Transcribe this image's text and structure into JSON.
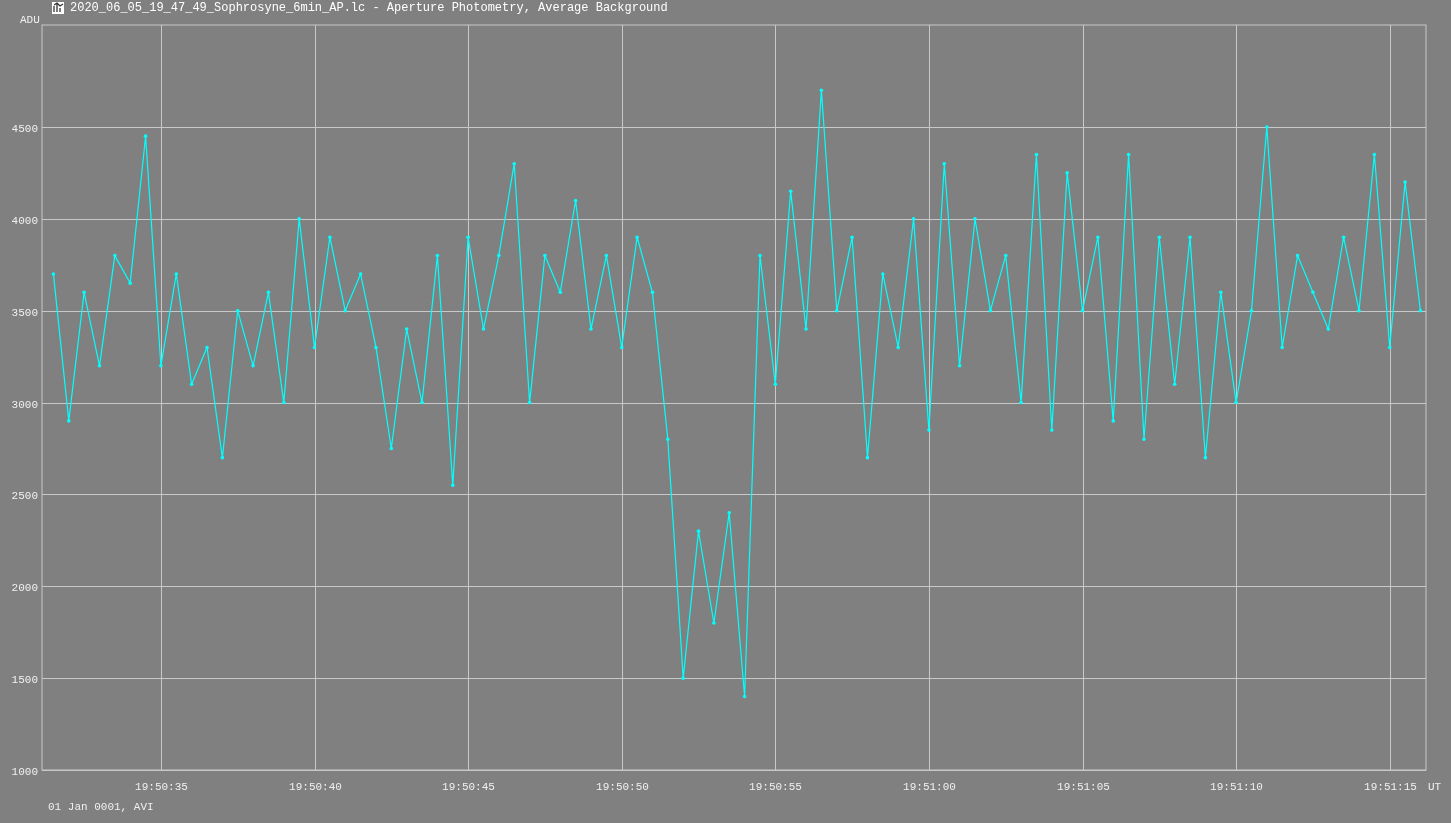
{
  "window": {
    "title": "2020_06_05_19_47_49_Sophrosyne_6min_AP.lc - Aperture Photometry, Average Background"
  },
  "chart": {
    "footer": "01 Jan 0001, AVI",
    "x_unit": "UT",
    "chart_data": {
      "type": "line",
      "grid": true,
      "ylabel": "ADU",
      "ylim": [
        1000,
        5055
      ],
      "yticks": [
        1000,
        1500,
        2000,
        2500,
        3000,
        3500,
        4000,
        4500
      ],
      "categories": [
        null,
        null,
        null,
        null,
        null,
        null,
        null,
        "19:50:35",
        null,
        null,
        null,
        null,
        null,
        null,
        null,
        null,
        null,
        "19:50:40",
        null,
        null,
        null,
        null,
        null,
        null,
        null,
        null,
        null,
        "19:50:45",
        null,
        null,
        null,
        null,
        null,
        null,
        null,
        null,
        null,
        "19:50:50",
        null,
        null,
        null,
        null,
        null,
        null,
        null,
        null,
        null,
        "19:50:55",
        null,
        null,
        null,
        null,
        null,
        null,
        null,
        null,
        null,
        "19:51:00",
        null,
        null,
        null,
        null,
        null,
        null,
        null,
        null,
        null,
        "19:51:05",
        null,
        null,
        null,
        null,
        null,
        null,
        null,
        null,
        null,
        "19:51:10",
        null,
        null,
        null,
        null,
        null,
        null,
        null,
        null,
        null,
        "19:51:15",
        null,
        null
      ],
      "series": [
        {
          "color": "#00ffff",
          "values": [
            3700,
            2900,
            3600,
            3200,
            3800,
            3650,
            4450,
            3200,
            3700,
            3100,
            3300,
            2700,
            3500,
            3200,
            3600,
            3000,
            4000,
            3300,
            3900,
            3500,
            3700,
            3300,
            2750,
            3400,
            3000,
            3800,
            2550,
            3900,
            3400,
            3800,
            4300,
            3000,
            3800,
            3600,
            4100,
            3400,
            3800,
            3300,
            3900,
            3600,
            2800,
            1500,
            2300,
            1800,
            2400,
            1400,
            3800,
            3100,
            4150,
            3400,
            4700,
            3500,
            3900,
            2700,
            3700,
            3300,
            4000,
            2850,
            4300,
            3200,
            4000,
            3500,
            3800,
            3000,
            4350,
            2850,
            4250,
            3500,
            3900,
            2900,
            4350,
            2800,
            3900,
            3100,
            3900,
            2700,
            3600,
            3000,
            3500,
            4500,
            3300,
            3800,
            3600,
            3400,
            3900,
            3500,
            4350,
            3300,
            4200,
            3500
          ]
        }
      ]
    }
  }
}
